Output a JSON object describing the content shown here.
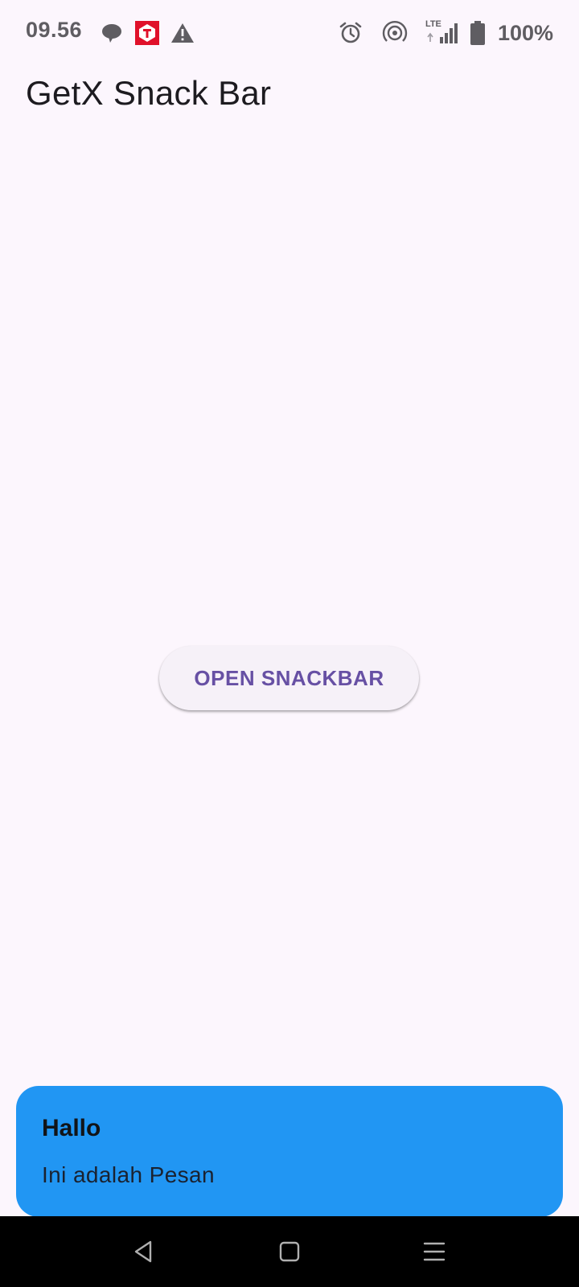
{
  "status_bar": {
    "time": "09.56",
    "battery_text": "100%",
    "network_label": "LTE",
    "notification_icons": [
      "chat-bubble-icon",
      "telkomsel-app-icon",
      "warning-icon"
    ],
    "system_icons": [
      "alarm-icon",
      "hotspot-icon",
      "lte-signal-icon",
      "battery-icon"
    ]
  },
  "app_bar": {
    "title": "GetX Snack Bar"
  },
  "main": {
    "button_label": "OPEN SNACKBAR"
  },
  "snackbar": {
    "title": "Hallo",
    "message": "Ini adalah Pesan",
    "background_color": "#2196f3"
  },
  "nav_bar": {
    "buttons": [
      "back-icon",
      "home-icon",
      "menu-icon"
    ]
  },
  "colors": {
    "background": "#fcf6fd",
    "accent": "#6750a4",
    "status_text": "#5f5d62"
  }
}
